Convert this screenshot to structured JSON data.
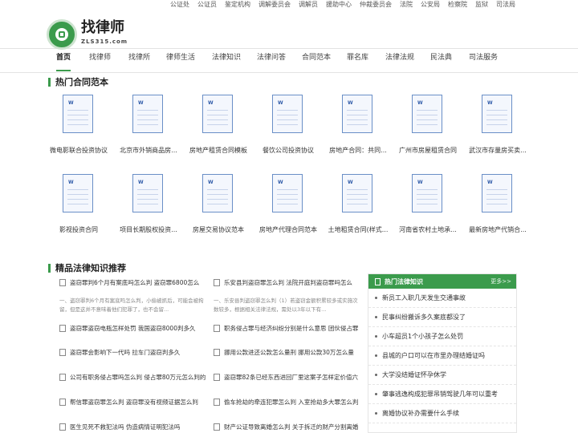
{
  "top_links": [
    "公证处",
    "公证员",
    "鉴定机构",
    "调解委员会",
    "调解员",
    "援助中心",
    "仲裁委员会",
    "法院",
    "公安局",
    "检察院",
    "监狱",
    "司法局"
  ],
  "brand": {
    "name": "找律师",
    "domain": "ZLS315.com",
    "logo_text": "找律师网"
  },
  "nav": [
    {
      "label": "首页",
      "active": true
    },
    {
      "label": "找律师"
    },
    {
      "label": "找律所"
    },
    {
      "label": "律师生活"
    },
    {
      "label": "法律知识"
    },
    {
      "label": "法律问答"
    },
    {
      "label": "合同范本"
    },
    {
      "label": "罪名库"
    },
    {
      "label": "法律法规"
    },
    {
      "label": "民法典"
    },
    {
      "label": "司法服务"
    }
  ],
  "contracts": {
    "title": "热门合同范本",
    "items": [
      {
        "title": "微电影联合投资协议"
      },
      {
        "title": "北京市外销商品房..."
      },
      {
        "title": "房地产租赁合同模板"
      },
      {
        "title": "餐饮公司投资协议"
      },
      {
        "title": "房地产合同：共同..."
      },
      {
        "title": "广州市房屋租赁合同"
      },
      {
        "title": "武汉市存量房买卖..."
      },
      {
        "title": "影视投资合同"
      },
      {
        "title": "项目长期股权投资..."
      },
      {
        "title": "房屋交易协议范本"
      },
      {
        "title": "房地产代理合同范本"
      },
      {
        "title": "土地租赁合同(样式..."
      },
      {
        "title": "河南省农村土地承..."
      },
      {
        "title": "最新房地产代销合..."
      }
    ]
  },
  "knowledge": {
    "title": "精品法律知识推荐",
    "left": [
      {
        "title": "盗窃罪判6个月有案底吗怎么判 盗窃罪6800怎么",
        "snippet": "一、盗窃罪判6个月有案底吗怎么判，小偷被抓后，可能会被拘留，但是这并不意味着他们犯罪了，也不会留..."
      },
      {
        "title": "盗窃罪盗窃电瓶怎样处罚 我国盗窃8000判多久"
      },
      {
        "title": "盗窃罪会影响下一代吗 拉车门盗窃判多久"
      },
      {
        "title": "公司有职务侵占罪吗怎么判 侵占罪80万元怎么判的"
      },
      {
        "title": "帮信罪盗窃罪怎么判 盗窃罪没有视频证据怎么判"
      },
      {
        "title": "医生见死不救犯法吗 伪造病情证明犯法吗"
      }
    ],
    "right": [
      {
        "title": "乐安县判盗窃罪怎么判 法院开庭判盗窃罪吗怎么",
        "snippet": "一、乐安县判盗窃罪怎么判（1）若盗窃金额积累较多或实施次数较多，根据相关法律法规，需处以3年以下有..."
      },
      {
        "title": "职务侵占罪与经济纠纷分别是什么意思 团伙侵占罪"
      },
      {
        "title": "挪用公款进还公款怎么量刑 挪用公款30万怎么量"
      },
      {
        "title": "盗窃罪82条已经东西进回厂里这案子怎样定价值六"
      },
      {
        "title": "偷车抢劫的牵连犯罪怎么判 入室抢劫多大罪怎么判"
      },
      {
        "title": "财产公证导致离婚怎么判 关于拆迁的财产分割离婚"
      }
    ]
  },
  "hot_news": {
    "title": "热门法律知识",
    "more": "更多>>",
    "items": [
      "新员工入职几天发生交通事故",
      "民事纠纷搬诉多久案底都没了",
      "小车超员1个小孩子怎么处罚",
      "县城的户口可以在市里办理结婚证吗",
      "大学没结婚证怀孕休学",
      "肇事逃逸构成犯罪吊销驾驶几年可以重考",
      "离婚协议补办需要什么手续"
    ]
  }
}
